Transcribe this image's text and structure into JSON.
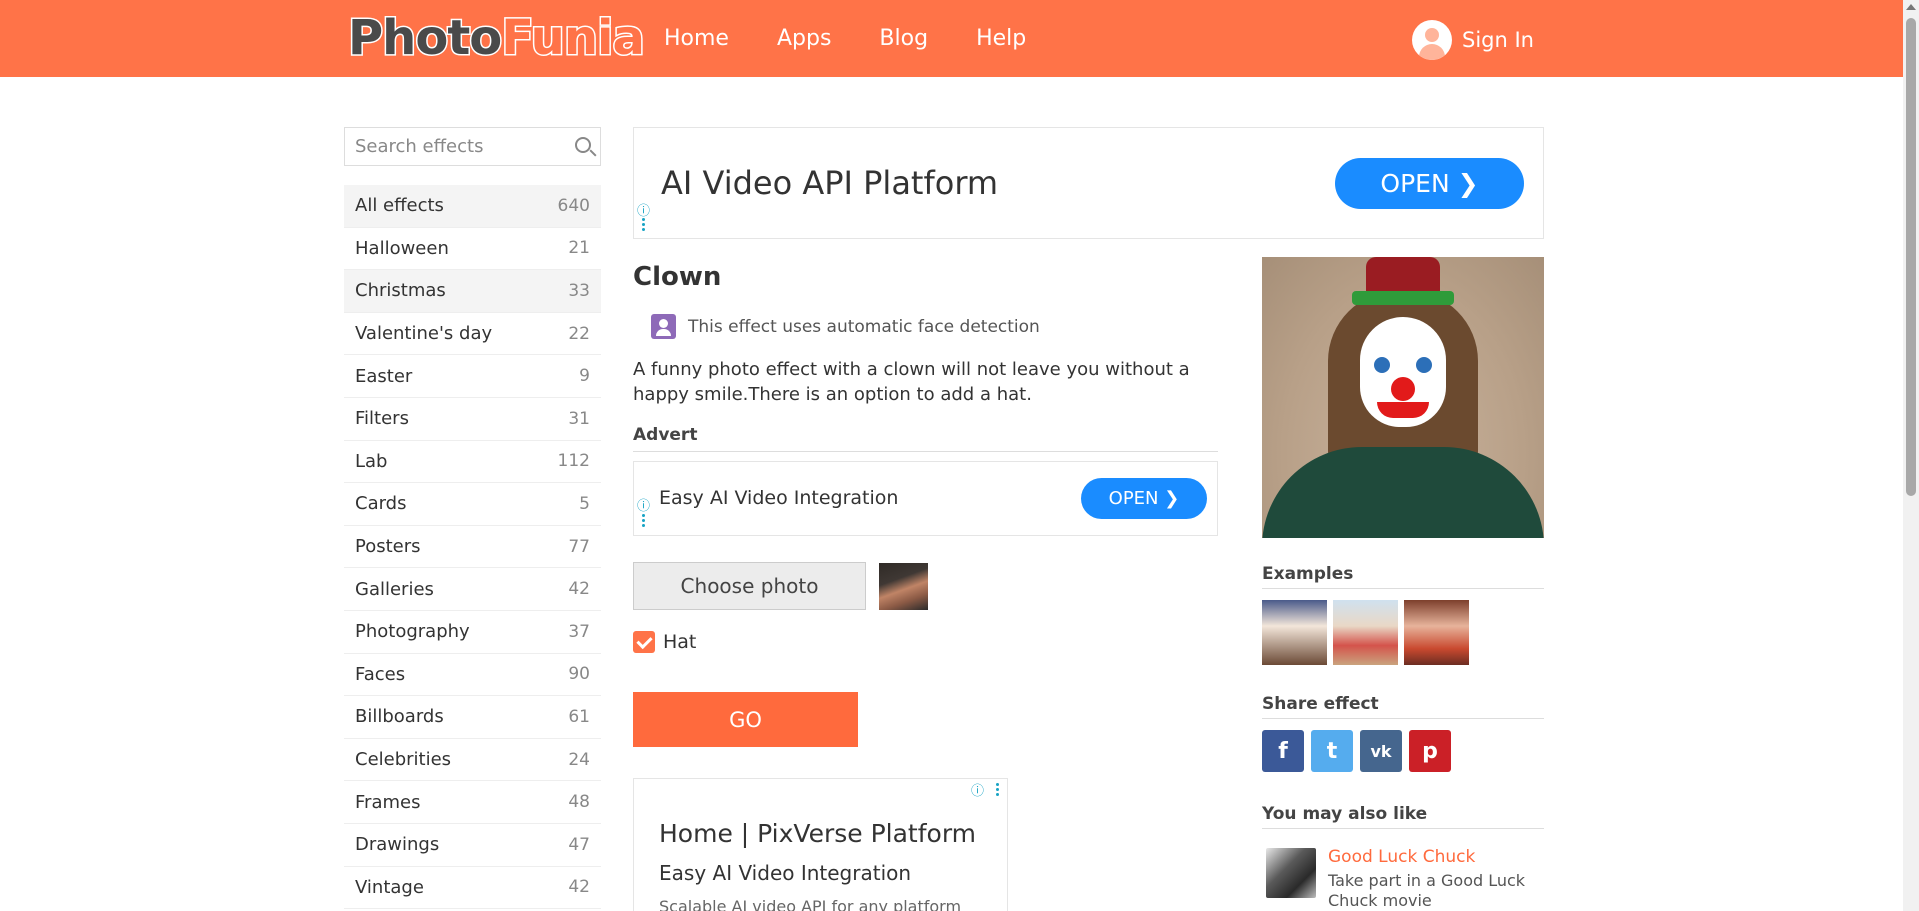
{
  "header": {
    "logo_part1": "Photo",
    "logo_part2": "Funia",
    "nav": [
      "Home",
      "Apps",
      "Blog",
      "Help"
    ],
    "sign_in": "Sign In"
  },
  "sidebar": {
    "search_placeholder": "Search effects",
    "categories": [
      {
        "label": "All effects",
        "count": "640"
      },
      {
        "label": "Halloween",
        "count": "21"
      },
      {
        "label": "Christmas",
        "count": "33"
      },
      {
        "label": "Valentine's day",
        "count": "22"
      },
      {
        "label": "Easter",
        "count": "9"
      },
      {
        "label": "Filters",
        "count": "31"
      },
      {
        "label": "Lab",
        "count": "112"
      },
      {
        "label": "Cards",
        "count": "5"
      },
      {
        "label": "Posters",
        "count": "77"
      },
      {
        "label": "Galleries",
        "count": "42"
      },
      {
        "label": "Photography",
        "count": "37"
      },
      {
        "label": "Faces",
        "count": "90"
      },
      {
        "label": "Billboards",
        "count": "61"
      },
      {
        "label": "Celebrities",
        "count": "24"
      },
      {
        "label": "Frames",
        "count": "48"
      },
      {
        "label": "Drawings",
        "count": "47"
      },
      {
        "label": "Vintage",
        "count": "42"
      }
    ]
  },
  "ads": {
    "top_title": "AI Video API Platform",
    "top_button": "OPEN",
    "mid_text": "Easy AI Video Integration",
    "mid_button": "OPEN",
    "bottom_heading": "Home | PixVerse Platform",
    "bottom_sub": "Easy AI Video Integration",
    "bottom_text": "Scalable AI video API for any platform"
  },
  "effect": {
    "title": "Clown",
    "face_note": "This effect uses automatic face detection",
    "description": "A funny photo effect with a clown will not leave you without a happy smile.There is an option to add a hat.",
    "advert_label": "Advert",
    "choose_photo": "Choose photo",
    "hat_label": "Hat",
    "hat_checked": true,
    "go_button": "GO"
  },
  "right": {
    "examples_heading": "Examples",
    "share_heading": "Share effect",
    "share": {
      "facebook": "f",
      "twitter": "t",
      "vk": "vk",
      "pinterest": "p"
    },
    "also_heading": "You may also like",
    "also_title": "Good Luck Chuck",
    "also_desc": "Take part in a Good Luck Chuck movie"
  },
  "colors": {
    "brand": "#ff7348",
    "go": "#ff6a3d",
    "open": "#1a8cff"
  }
}
